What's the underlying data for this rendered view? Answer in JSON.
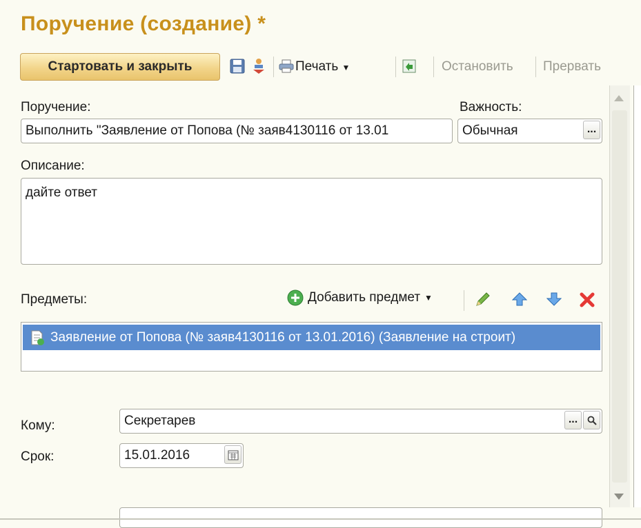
{
  "window": {
    "title": "Поручение (создание) *"
  },
  "toolbar": {
    "start_close_label": "Стартовать и закрыть",
    "print_label": "Печать",
    "stop_label": "Остановить",
    "abort_label": "Прервать"
  },
  "form": {
    "task_label": "Поручение:",
    "task_value": "Выполнить \"Заявление от Попова (№ заяв4130116 от 13.01",
    "importance_label": "Важность:",
    "importance_value": "Обычная",
    "description_label": "Описание:",
    "description_value": "дайте ответ",
    "subjects_label": "Предметы:",
    "add_subject_label": "Добавить предмет",
    "subjects": [
      {
        "text": "Заявление от Попова (№ заяв4130116 от 13.01.2016) (Заявление на строит)"
      }
    ],
    "to_label": "Кому:",
    "to_value": "Секретарев",
    "due_label": "Срок:",
    "due_value": "15.01.2016"
  },
  "icons": {
    "save": "save-icon",
    "route": "route-icon",
    "print": "printer-icon",
    "ref": "reference-icon",
    "add": "add-icon",
    "edit": "pencil-icon",
    "up": "arrow-up-icon",
    "down": "arrow-down-icon",
    "delete": "delete-icon",
    "calendar": "calendar-icon",
    "search": "search-icon"
  },
  "colors": {
    "title": "#c8901c",
    "selection": "#5a8ccf",
    "background": "#fbfbf2"
  }
}
